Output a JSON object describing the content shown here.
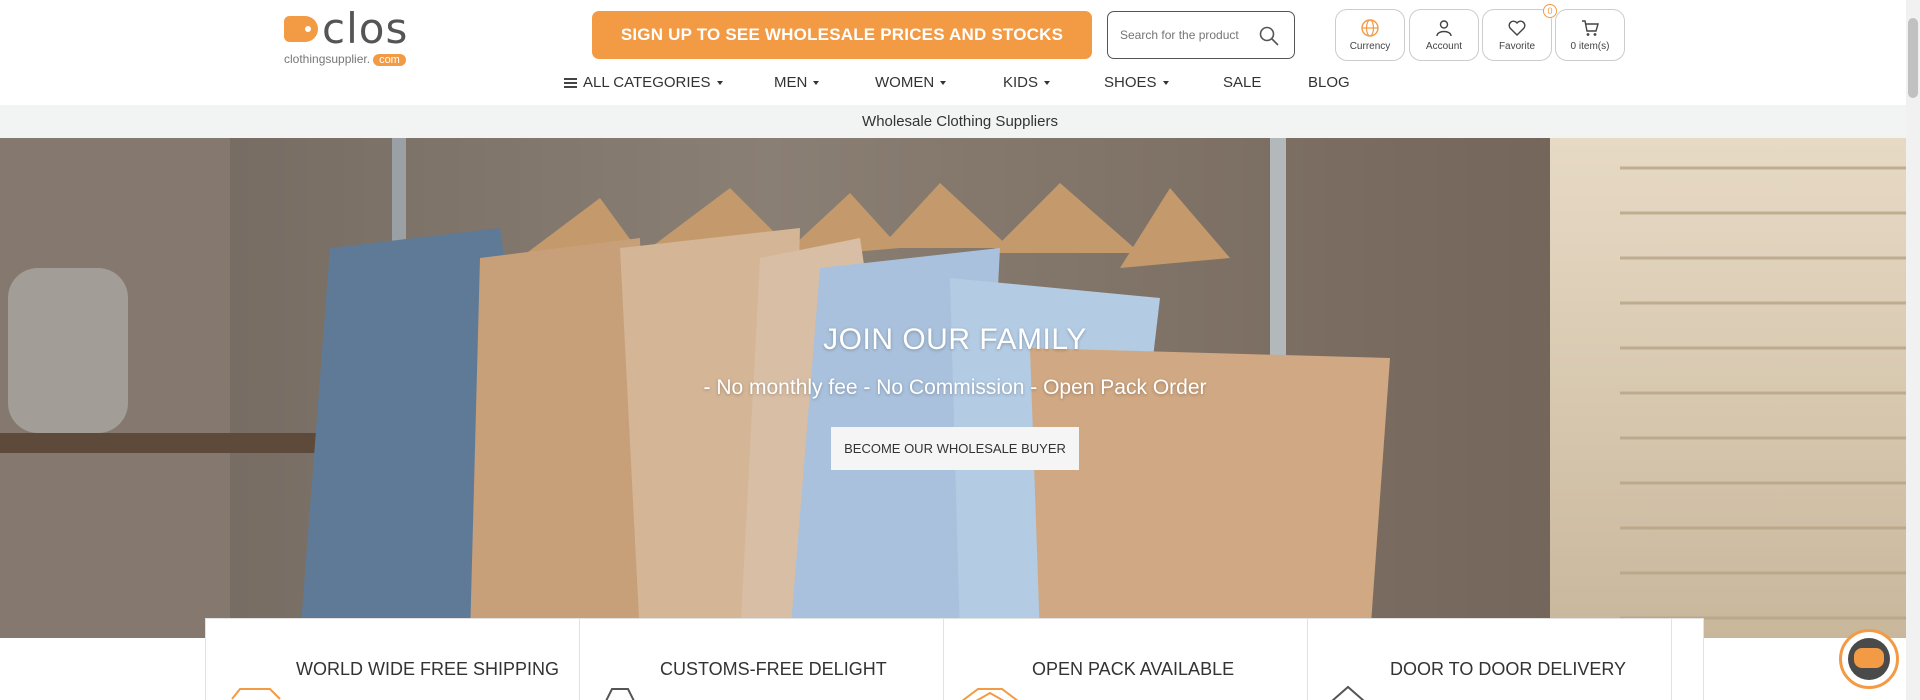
{
  "brand": {
    "logo_word": "clos",
    "logo_sub": "clothingsupplier.",
    "logo_sub_pill": "com",
    "accent_color": "#f39a45"
  },
  "header": {
    "signup_label": "SIGN UP TO SEE WHOLESALE PRICES AND STOCKS",
    "search_placeholder": "Search for the product",
    "icons": [
      {
        "name": "globe-icon",
        "label": "Currency"
      },
      {
        "name": "user-icon",
        "label": "Account"
      },
      {
        "name": "heart-icon",
        "label": "Favorite",
        "badge": "0"
      },
      {
        "name": "cart-icon",
        "label": "0 item(s)"
      }
    ]
  },
  "nav": {
    "items": [
      {
        "label": "ALL CATEGORIES",
        "dropdown": true
      },
      {
        "label": "MEN",
        "dropdown": true
      },
      {
        "label": "WOMEN",
        "dropdown": true
      },
      {
        "label": "KIDS",
        "dropdown": true
      },
      {
        "label": "SHOES",
        "dropdown": true
      },
      {
        "label": "SALE",
        "dropdown": false
      },
      {
        "label": "BLOG",
        "dropdown": false
      }
    ]
  },
  "subbar": {
    "text": "Wholesale Clothing Suppliers"
  },
  "hero": {
    "title": "JOIN OUR FAMILY",
    "subtitle": "- No monthly fee - No Commission - Open Pack Order",
    "button_label": "BECOME OUR WHOLESALE BUYER"
  },
  "features": [
    {
      "title": "WORLD WIDE FREE SHIPPING",
      "icon": "truck-icon"
    },
    {
      "title": "CUSTOMS-FREE DELIGHT",
      "icon": "badge-icon"
    },
    {
      "title": "OPEN PACK AVAILABLE",
      "icon": "box-icon"
    },
    {
      "title": "DOOR TO DOOR DELIVERY",
      "icon": "house-icon"
    }
  ]
}
